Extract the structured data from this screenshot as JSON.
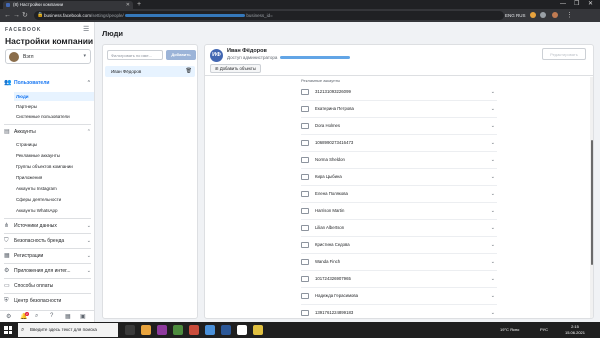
{
  "browser": {
    "tab_title": "(8) Настройки компании",
    "new_tab": "+",
    "url_host": "business.facebook.com",
    "url_path": "/settings/people/",
    "url_tail": "business_id=",
    "lang": "ENG RUS",
    "win_min": "—",
    "win_max": "❐",
    "win_close": "✕",
    "back": "←",
    "forward": "→",
    "reload": "↻"
  },
  "sidebar": {
    "brand": "FACEBOOK",
    "title": "Настройки компании",
    "account_name": "Вэгл",
    "sections": [
      {
        "label": "Пользователи",
        "icon": "people-icon"
      },
      {
        "label": "Аккаунты",
        "icon": "briefcase-icon"
      },
      {
        "label": "Источники данных",
        "icon": "data-sources-icon"
      },
      {
        "label": "Безопасность бренда",
        "icon": "shield-icon"
      },
      {
        "label": "Регистрации",
        "icon": "registration-icon"
      },
      {
        "label": "Приложения для интег...",
        "icon": "integrations-icon"
      },
      {
        "label": "Способы оплаты",
        "icon": "credit-card-icon"
      },
      {
        "label": "Центр безопасности",
        "icon": "security-center-icon"
      }
    ],
    "users_sub": [
      "Люди",
      "Партнеры",
      "Системные пользователи"
    ],
    "accounts_sub": [
      "Страницы",
      "Рекламные аккаунты",
      "Группы объектов компании",
      "Приложения",
      "Аккаунты Instagram",
      "Сферы деятельности",
      "Аккаунты WhatsApp"
    ],
    "notification_count": "2"
  },
  "main": {
    "title": "Люди",
    "search_placeholder": "Фильтровать по име...",
    "add_button": "Добавить",
    "people": [
      "Иван Фёдоров"
    ]
  },
  "detail": {
    "initials": "ИФ",
    "name": "Иван Фёдоров",
    "role": "Доступ администратора",
    "add_objects": "Добавить объекты",
    "edit_button": "Редактировать",
    "list_header": "Рекламные аккаунты",
    "accounts": [
      "312131093226099",
      "Екатерина Петрова",
      "Dora Holmes",
      "1068990273416473",
      "Norma Sheldon",
      "Кира Цыбина",
      "Елена Полякова",
      "Harrison Martin",
      "Lilian Albertson",
      "Кристина Седова",
      "Wanda Finch",
      "101724326907965",
      "Надежда Герасимова",
      "1391761224899183"
    ]
  },
  "taskbar": {
    "search_text": "Введите здесь текст для поиска",
    "temperature": "19°C Ясно",
    "lang": "РУС",
    "time": "2:15",
    "date": "15.06.2021"
  }
}
